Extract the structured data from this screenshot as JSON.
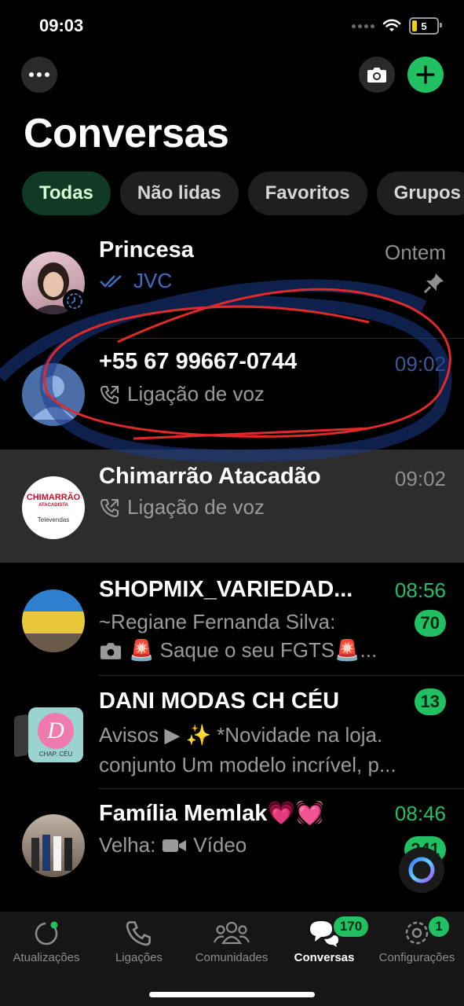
{
  "status": {
    "time": "09:03",
    "battery": "5"
  },
  "header": {
    "title": "Conversas",
    "more_icon": "ellipsis-icon",
    "camera_icon": "camera-icon",
    "new_icon": "plus-icon"
  },
  "filters": [
    {
      "label": "Todas",
      "active": true
    },
    {
      "label": "Não lidas",
      "active": false
    },
    {
      "label": "Favoritos",
      "active": false
    },
    {
      "label": "Grupos",
      "active": false
    }
  ],
  "chats": [
    {
      "name": "Princesa",
      "time": "Ontem",
      "preview": "JVC",
      "pinned": true,
      "read_ticks": true
    },
    {
      "name": "+55 67 99667-0744",
      "time": "09:02",
      "preview": "Ligação de voz",
      "call_icon": "outgoing-call-icon"
    },
    {
      "name": "Chimarrão Atacadão",
      "time": "09:02",
      "preview": "Ligação de voz",
      "call_icon": "outgoing-call-icon",
      "avatar_text": "CHIMARRÃO",
      "avatar_sub": "ATACADISTA",
      "avatar_caption": "Televendas"
    },
    {
      "name": "SHOPMIX_VARIEDAD...",
      "time": "08:56",
      "preview_line1": "~Regiane Fernanda Silva:",
      "preview_line2": "🚨 Saque o seu FGTS🚨...",
      "unread": "70"
    },
    {
      "name": "DANI MODAS CH CÉU",
      "unread": "13",
      "preview_line1": "Avisos ▶ ✨ *Novidade na loja.",
      "preview_line2": "conjunto  Um modelo incrível, p...",
      "avatar_letter": "D",
      "avatar_caption": "CHAP. CÉU"
    },
    {
      "name": "Família Memlak💗💓",
      "time": "08:46",
      "preview_prefix": "Velha:",
      "preview": "Vídeo",
      "unread": "241"
    }
  ],
  "tabs": [
    {
      "label": "Atualizações",
      "icon": "updates-icon"
    },
    {
      "label": "Ligações",
      "icon": "phone-icon"
    },
    {
      "label": "Comunidades",
      "icon": "communities-icon"
    },
    {
      "label": "Conversas",
      "icon": "chats-icon",
      "badge": "170",
      "active": true
    },
    {
      "label": "Configurações",
      "icon": "settings-icon",
      "badge": "1"
    }
  ],
  "colors": {
    "accent": "#21c063",
    "annotation": "#e02a2a",
    "highlight": "#2d2d2d"
  }
}
